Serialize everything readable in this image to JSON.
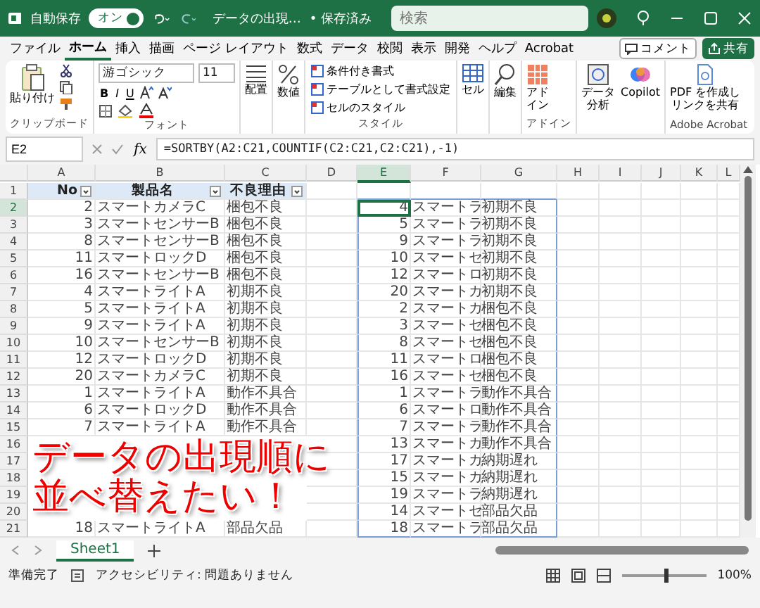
{
  "title_bar": {
    "autosave_label": "自動保存",
    "autosave_toggle": {
      "label": "オン",
      "on": true
    },
    "file_name": "データの出現…",
    "save_status": "• 保存済み",
    "search": {
      "placeholder": "検索"
    }
  },
  "tabs": [
    {
      "label": "ファイル",
      "selected": false
    },
    {
      "label": "ホーム",
      "selected": true
    },
    {
      "label": "挿入",
      "selected": false
    },
    {
      "label": "描画",
      "selected": false
    },
    {
      "label": "ページ レイアウト",
      "selected": false
    },
    {
      "label": "数式",
      "selected": false
    },
    {
      "label": "データ",
      "selected": false
    },
    {
      "label": "校閲",
      "selected": false
    },
    {
      "label": "表示",
      "selected": false
    },
    {
      "label": "開発",
      "selected": false
    },
    {
      "label": "ヘルプ",
      "selected": false
    },
    {
      "label": "Acrobat",
      "selected": false
    }
  ],
  "comment_button": "コメント",
  "share_button": "共有",
  "ribbon": {
    "paste": "貼り付け",
    "clipboard_group": "クリップボード",
    "font_name": "游ゴシック",
    "font_size": "11",
    "bold": "B",
    "italic": "I",
    "underline": "U",
    "font_group": "フォント",
    "alignment": "配置",
    "number": "数値",
    "styles": [
      "条件付き書式",
      "テーブルとして書式設定",
      "セルのスタイル"
    ],
    "styles_group": "スタイル",
    "cells": "セル",
    "editing": "編集",
    "addin": [
      "アド",
      "イン"
    ],
    "addin_group": "アドイン",
    "data_analysis": [
      "データ",
      "分析"
    ],
    "copilot": "Copilot",
    "pdf": [
      "PDF を作成し",
      "リンクを共有"
    ],
    "acrobat_group": "Adobe Acrobat"
  },
  "formula_bar": {
    "name_box": "E2",
    "fx": "fx",
    "formula": "=SORTBY(A2:C21,COUNTIF(C2:C21,C2:C21),-1)"
  },
  "columns": [
    "A",
    "B",
    "C",
    "D",
    "E",
    "F",
    "G",
    "H",
    "I",
    "J",
    "K",
    "L"
  ],
  "header_row": {
    "row": "1",
    "a": "No",
    "b": "製品名",
    "c": "不良理由"
  },
  "rows": [
    {
      "row": "2",
      "a": "2",
      "b": "スマートカメラC",
      "c": "梱包不良",
      "e": "4",
      "f": "スマートラ",
      "g": "初期不良"
    },
    {
      "row": "3",
      "a": "3",
      "b": "スマートセンサーB",
      "c": "梱包不良",
      "e": "5",
      "f": "スマートラ",
      "g": "初期不良"
    },
    {
      "row": "4",
      "a": "8",
      "b": "スマートセンサーB",
      "c": "梱包不良",
      "e": "9",
      "f": "スマートラ",
      "g": "初期不良"
    },
    {
      "row": "5",
      "a": "11",
      "b": "スマートロックD",
      "c": "梱包不良",
      "e": "10",
      "f": "スマートセ",
      "g": "初期不良"
    },
    {
      "row": "6",
      "a": "16",
      "b": "スマートセンサーB",
      "c": "梱包不良",
      "e": "12",
      "f": "スマートロ",
      "g": "初期不良"
    },
    {
      "row": "7",
      "a": "4",
      "b": "スマートライトA",
      "c": "初期不良",
      "e": "20",
      "f": "スマートカ",
      "g": "初期不良"
    },
    {
      "row": "8",
      "a": "5",
      "b": "スマートライトA",
      "c": "初期不良",
      "e": "2",
      "f": "スマートカ",
      "g": "梱包不良"
    },
    {
      "row": "9",
      "a": "9",
      "b": "スマートライトA",
      "c": "初期不良",
      "e": "3",
      "f": "スマートセ",
      "g": "梱包不良"
    },
    {
      "row": "10",
      "a": "10",
      "b": "スマートセンサーB",
      "c": "初期不良",
      "e": "8",
      "f": "スマートセ",
      "g": "梱包不良"
    },
    {
      "row": "11",
      "a": "12",
      "b": "スマートロックD",
      "c": "初期不良",
      "e": "11",
      "f": "スマートロ",
      "g": "梱包不良"
    },
    {
      "row": "12",
      "a": "20",
      "b": "スマートカメラC",
      "c": "初期不良",
      "e": "16",
      "f": "スマートセ",
      "g": "梱包不良"
    },
    {
      "row": "13",
      "a": "1",
      "b": "スマートライトA",
      "c": "動作不具合",
      "e": "1",
      "f": "スマートラ",
      "g": "動作不具合"
    },
    {
      "row": "14",
      "a": "6",
      "b": "スマートロックD",
      "c": "動作不具合",
      "e": "6",
      "f": "スマートロ",
      "g": "動作不具合"
    },
    {
      "row": "15",
      "a": "7",
      "b": "スマートライトA",
      "c": "動作不具合",
      "e": "7",
      "f": "スマートラ",
      "g": "動作不具合"
    },
    {
      "row": "16",
      "e": "13",
      "f": "スマートカ",
      "g": "動作不具合"
    },
    {
      "row": "17",
      "e": "17",
      "f": "スマートカ",
      "g": "納期遅れ"
    },
    {
      "row": "18",
      "e": "15",
      "f": "スマートカ",
      "g": "納期遅れ"
    },
    {
      "row": "19",
      "e": "19",
      "f": "スマートラ",
      "g": "納期遅れ"
    },
    {
      "row": "20",
      "e": "14",
      "f": "スマートセ",
      "g": "部品欠品"
    },
    {
      "row": "21",
      "a": "18",
      "b": "スマートライトA",
      "c": "部品欠品",
      "e": "18",
      "f": "スマートラ",
      "g": "部品欠品"
    }
  ],
  "caption": [
    "データの出現順に",
    "並べ替えたい！"
  ],
  "sheet_tabs": [
    {
      "label": "Sheet1",
      "selected": true
    }
  ],
  "status_bar": {
    "ready": "準備完了",
    "accessibility": "アクセシビリティ: 問題ありません",
    "zoom": {
      "level": 0.5
    },
    "zoom_value": "100%"
  }
}
